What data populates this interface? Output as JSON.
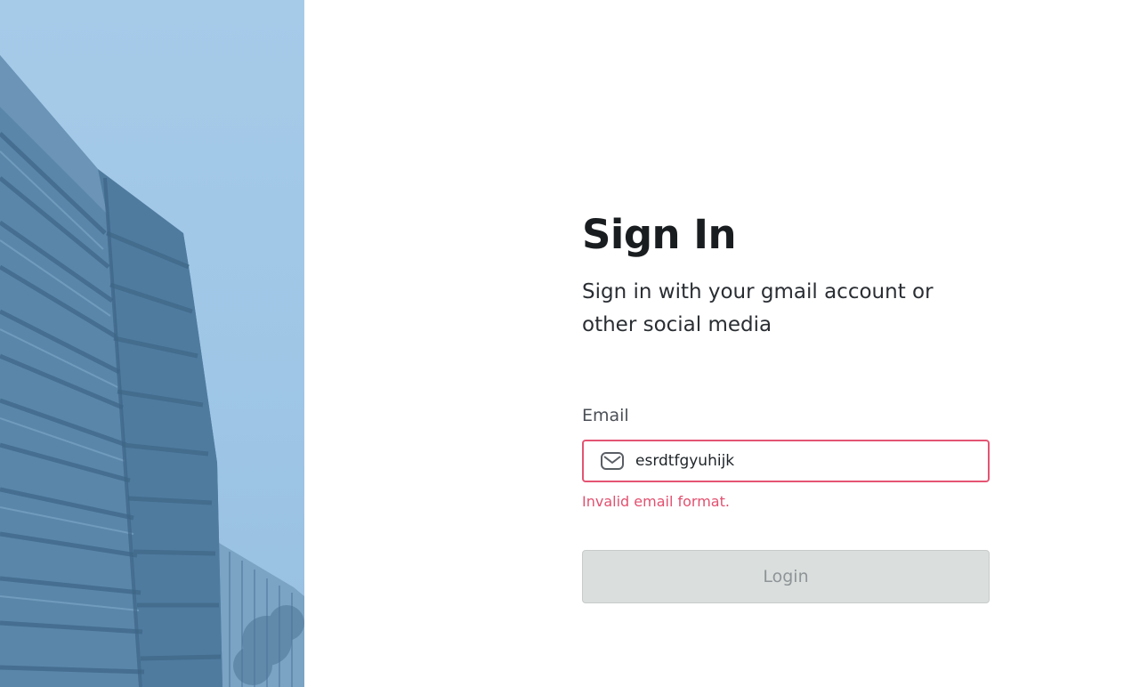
{
  "form": {
    "title": "Sign In",
    "subtitle": "Sign in with your gmail account or other social media",
    "email_label": "Email",
    "email_value": "esrdtfgyuhijk",
    "error_message": "Invalid email format.",
    "login_label": "Login"
  },
  "icons": {
    "email_field_icon": "envelope-icon"
  },
  "colors": {
    "error": "#e2506f",
    "input_border_error": "#e45473",
    "button_disabled_bg": "#dadedd",
    "button_disabled_text": "#8e9497"
  }
}
